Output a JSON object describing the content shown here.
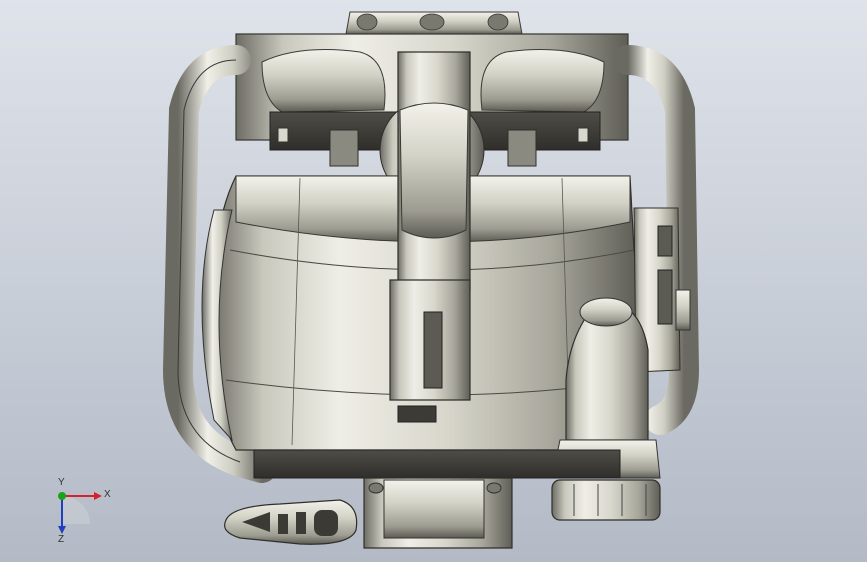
{
  "viewport": {
    "background_top": "#dfe3ea",
    "background_bottom": "#b3bac6"
  },
  "triad": {
    "x_label": "X",
    "y_label": "Y",
    "z_label": "Z",
    "x_color": "#d6202a",
    "y_color": "#19a319",
    "z_color": "#1f3fbf"
  }
}
